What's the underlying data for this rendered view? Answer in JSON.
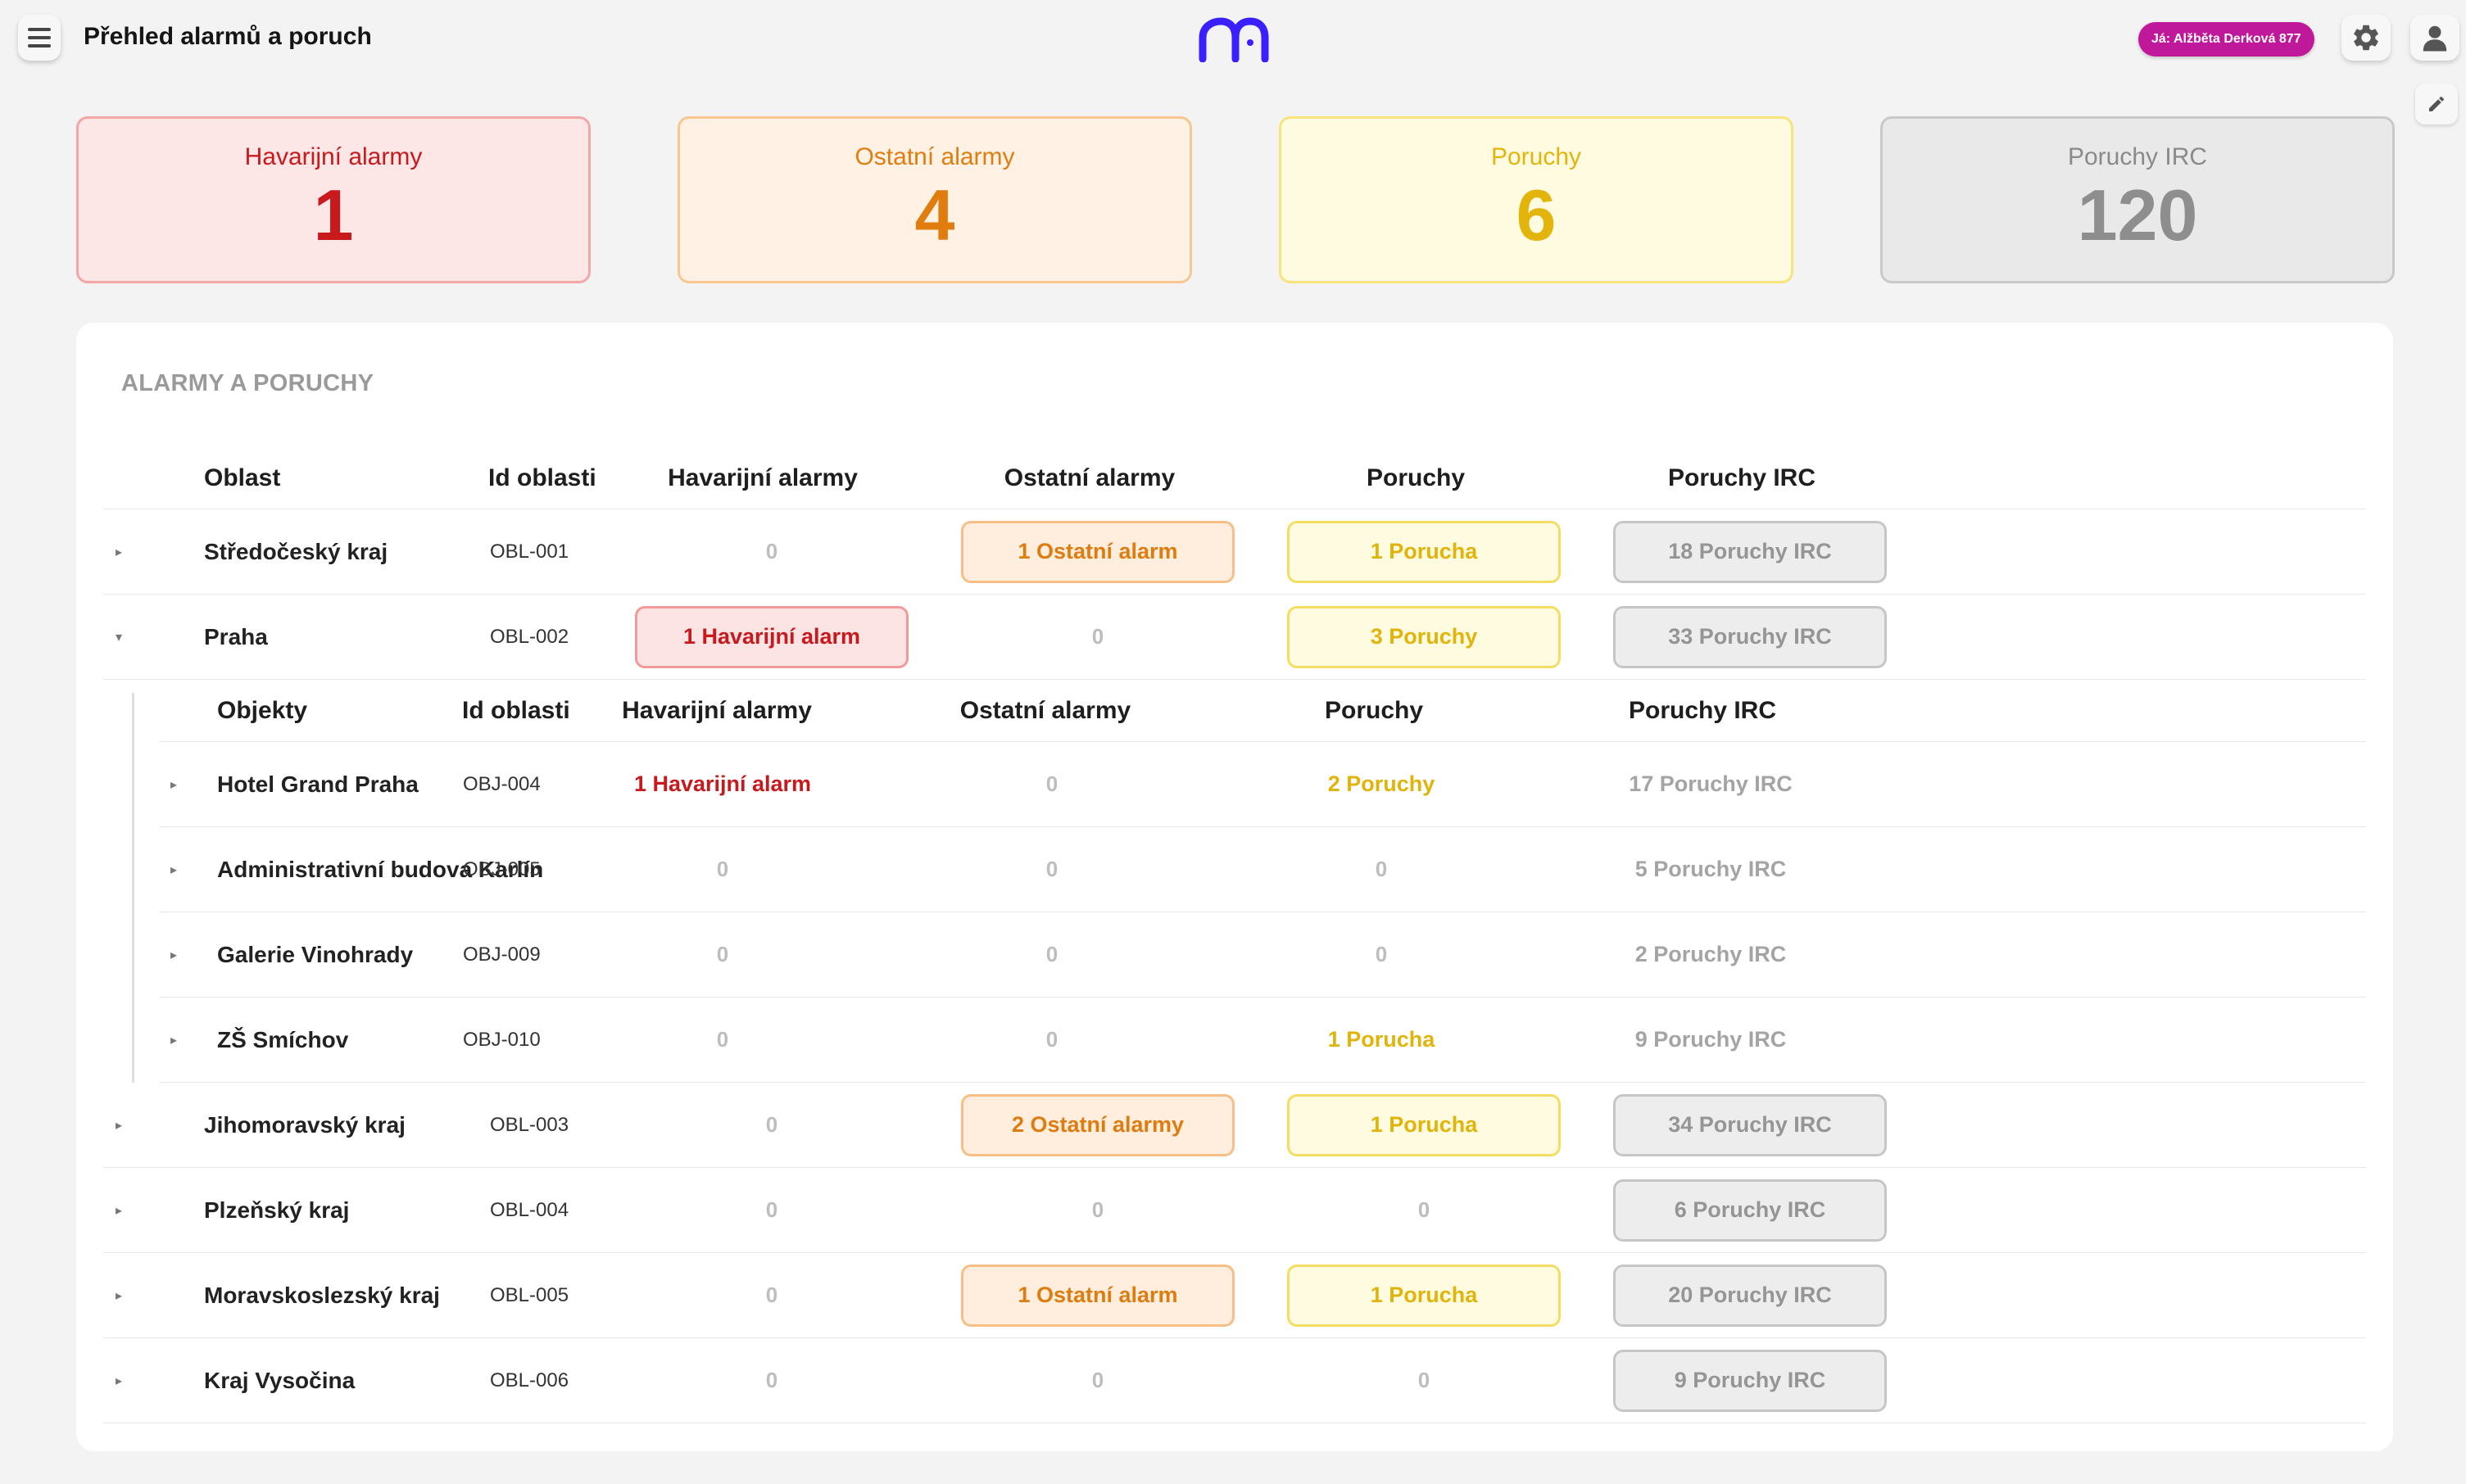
{
  "header": {
    "title": "Přehled alarmů a poruch",
    "user_badge": "Já: Alžběta Derková 877"
  },
  "colors": {
    "brand": "#3a1fff",
    "user_badge": "#c0189a",
    "emergency": "#c8191d",
    "other": "#e17d0f",
    "fault": "#e3b50c",
    "irc": "#8e8e8e"
  },
  "cards": [
    {
      "label": "Havarijní alarmy",
      "value": "1"
    },
    {
      "label": "Ostatní alarmy",
      "value": "4"
    },
    {
      "label": "Poruchy",
      "value": "6"
    },
    {
      "label": "Poruchy IRC",
      "value": "120"
    }
  ],
  "table": {
    "title": "ALARMY A PORUCHY",
    "columns": [
      "Oblast",
      "Id oblasti",
      "Havarijní alarmy",
      "Ostatní alarmy",
      "Poruchy",
      "Poruchy IRC"
    ],
    "regions": [
      {
        "name": "Středočeský kraj",
        "id": "OBL-001",
        "emergency": "0",
        "other": "1 Ostatní alarm",
        "faults": "1 Porucha",
        "irc": "18 Poruchy IRC"
      },
      {
        "name": "Praha",
        "id": "OBL-002",
        "emergency": "1 Havarijní alarm",
        "other": "0",
        "faults": "3 Poruchy",
        "irc": "33 Poruchy IRC"
      },
      {
        "name": "Jihomoravský kraj",
        "id": "OBL-003",
        "emergency": "0",
        "other": "2 Ostatní alarmy",
        "faults": "1 Porucha",
        "irc": "34 Poruchy IRC"
      },
      {
        "name": "Plzeňský kraj",
        "id": "OBL-004",
        "emergency": "0",
        "other": "0",
        "faults": "0",
        "irc": "6 Poruchy IRC"
      },
      {
        "name": "Moravskoslezský kraj",
        "id": "OBL-005",
        "emergency": "0",
        "other": "1 Ostatní alarm",
        "faults": "1 Porucha",
        "irc": "20 Poruchy IRC"
      },
      {
        "name": "Kraj Vysočina",
        "id": "OBL-006",
        "emergency": "0",
        "other": "0",
        "faults": "0",
        "irc": "9 Poruchy IRC"
      }
    ],
    "sub_columns": [
      "Objekty",
      "Id oblasti",
      "Havarijní alarmy",
      "Ostatní alarmy",
      "Poruchy",
      "Poruchy IRC"
    ],
    "objects": [
      {
        "name": "Hotel Grand Praha",
        "id": "OBJ-004",
        "emergency": "1 Havarijní alarm",
        "other": "0",
        "faults": "2 Poruchy",
        "irc": "17 Poruchy IRC"
      },
      {
        "name": "Administrativní budova Karlín",
        "id": "OBJ-005",
        "emergency": "0",
        "other": "0",
        "faults": "0",
        "irc": "5 Poruchy IRC"
      },
      {
        "name": "Galerie Vinohrady",
        "id": "OBJ-009",
        "emergency": "0",
        "other": "0",
        "faults": "0",
        "irc": "2 Poruchy IRC"
      },
      {
        "name": "ZŠ Smíchov",
        "id": "OBJ-010",
        "emergency": "0",
        "other": "0",
        "faults": "1 Porucha",
        "irc": "9 Poruchy IRC"
      }
    ]
  }
}
